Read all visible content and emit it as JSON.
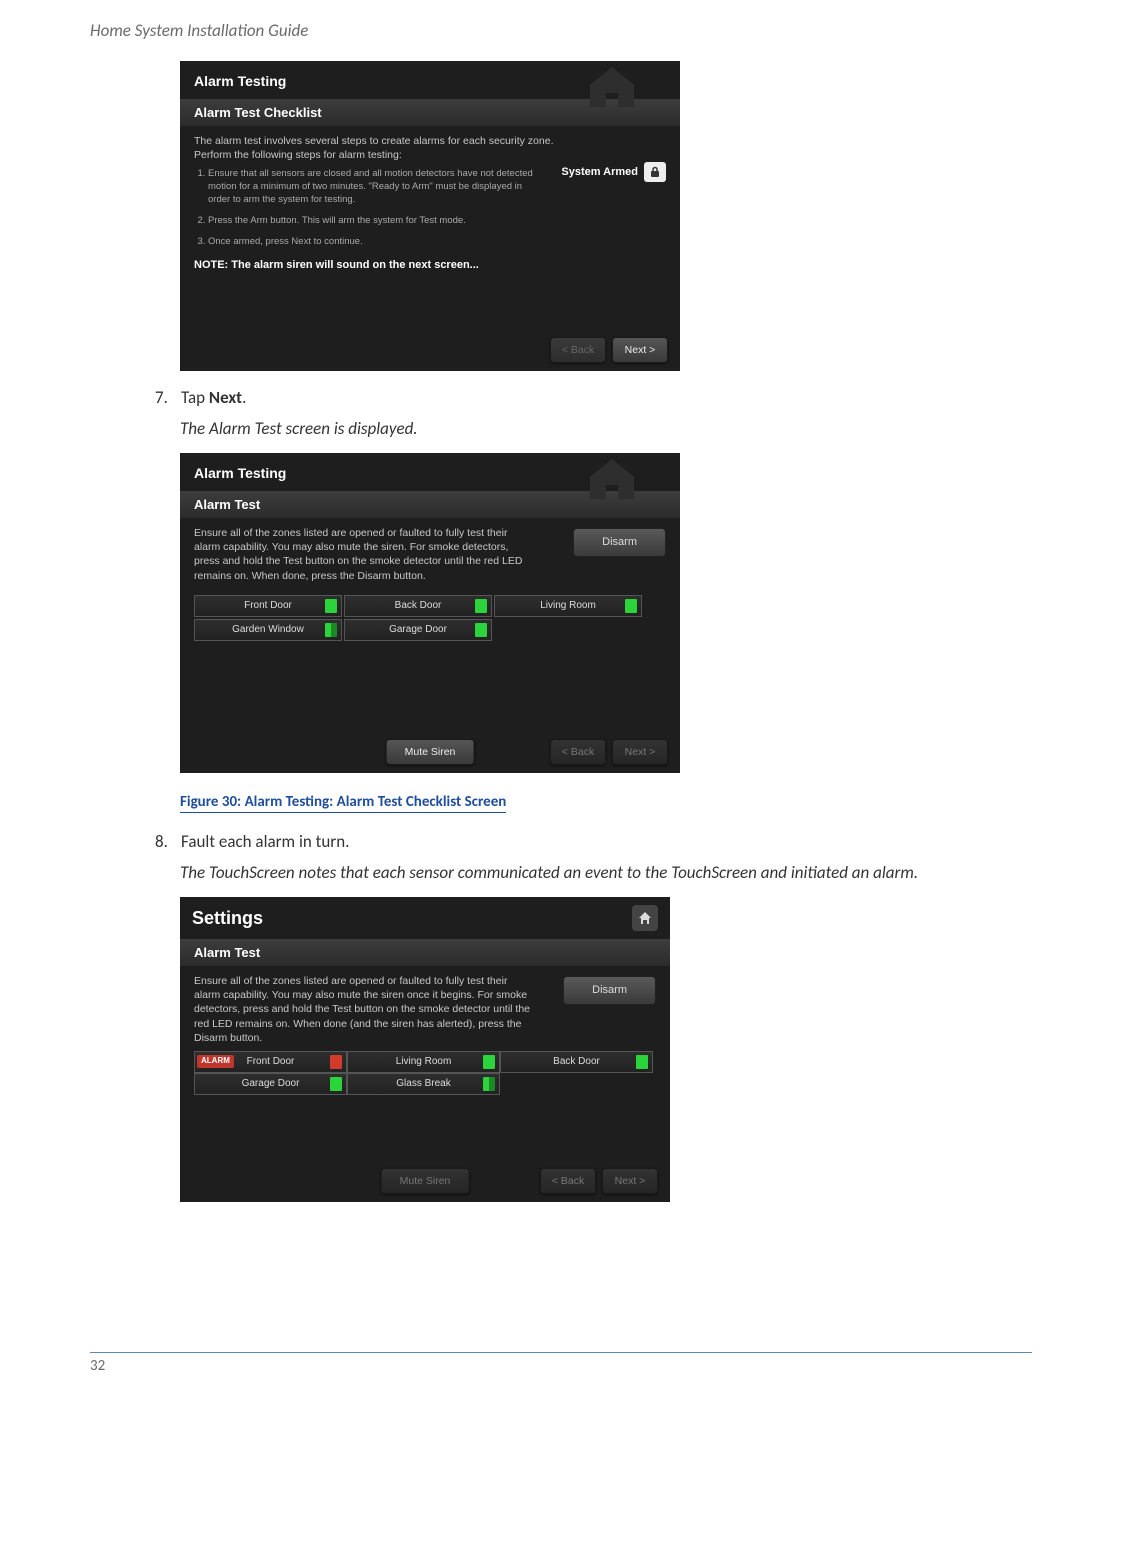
{
  "doc": {
    "header": "Home System Installation Guide",
    "page_number": "32"
  },
  "shot1": {
    "title": "Alarm Testing",
    "subtitle": "Alarm Test Checklist",
    "intro": "The alarm test involves several steps to create alarms for each security zone. Perform the following steps for alarm testing:",
    "armed_label": "System Armed",
    "li1": "Ensure that all sensors are closed and all motion detectors have not detected motion for a minimum of two minutes. \"Ready to Arm\" must be displayed in order to arm the system for testing.",
    "li2": "Press the Arm button. This will arm the system for Test mode.",
    "li3": "Once armed, press Next to continue.",
    "note": "NOTE: The alarm siren will sound on the next screen...",
    "back": "< Back",
    "next": "Next >"
  },
  "step7": {
    "num": "7.",
    "text_a": "Tap ",
    "text_b": "Next",
    "text_c": ".",
    "result": "The Alarm Test screen is displayed."
  },
  "shot2": {
    "title": "Alarm Testing",
    "subtitle": "Alarm Test",
    "intro": "Ensure all of the zones listed are opened or faulted to fully test their alarm capability.  You may also mute the siren. For smoke detectors, press and hold the Test button on the smoke detector until the red LED remains on.  When done, press the Disarm button.",
    "disarm": "Disarm",
    "zones": [
      "Front Door",
      "Back Door",
      "Living Room",
      "Garden Window",
      "Garage Door"
    ],
    "mute": "Mute Siren",
    "back": "< Back",
    "next": "Next >"
  },
  "fig30": "Figure 30:  Alarm Testing: Alarm Test Checklist Screen",
  "step8": {
    "num": "8.",
    "text": "Fault each alarm in turn.",
    "result": "The TouchScreen notes that each sensor communicated an event to the TouchScreen and initiated an alarm."
  },
  "shot3": {
    "title": "Settings",
    "subtitle": "Alarm Test",
    "intro": "Ensure all of the zones listed are opened or faulted to fully test their alarm capability.  You may also mute the siren once it begins. For smoke detectors, press and hold the Test button on the smoke detector until the red LED remains on.  When done (and the siren has alerted), press the Disarm button.",
    "disarm": "Disarm",
    "alarm_tag": "ALARM",
    "zones": [
      "Front Door",
      "Living Room",
      "Back Door",
      "Garage Door",
      "Glass Break"
    ],
    "mute": "Mute Siren",
    "back": "< Back",
    "next": "Next >"
  }
}
